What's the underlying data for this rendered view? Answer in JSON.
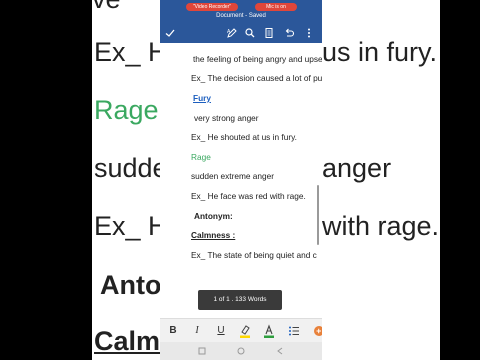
{
  "background": {
    "lines": [
      {
        "text": "ve",
        "green": false,
        "bold": false,
        "ul": false
      },
      {
        "text": "Ex_  He",
        "green": false,
        "bold": false,
        "ul": false
      },
      {
        "text": "us in fury.",
        "green": false,
        "bold": false,
        "ul": false
      },
      {
        "text": "Rage",
        "green": true,
        "bold": false,
        "ul": false
      },
      {
        "text": "suddenext",
        "green": false,
        "bold": false,
        "ul": false
      },
      {
        "text": "anger",
        "green": false,
        "bold": false,
        "ul": false
      },
      {
        "text": "Ex_  H",
        "green": false,
        "bold": false,
        "ul": false
      },
      {
        "text": "with rage.",
        "green": false,
        "bold": false,
        "ul": false
      },
      {
        "text": "Anto",
        "green": false,
        "bold": true,
        "ul": false
      },
      {
        "text": "Calmn",
        "green": false,
        "bold": true,
        "ul": true
      }
    ]
  },
  "status": {
    "left_pill": "\"Video Recorder\"",
    "right_pill": "Mic is on"
  },
  "appbar": {
    "title": "Document - Saved"
  },
  "toolbar": {
    "icons": [
      "check-icon",
      "pen-icon",
      "search-icon",
      "reading-view-icon",
      "undo-icon",
      "more-icon"
    ]
  },
  "document": {
    "lines": [
      {
        "text": "the feeling of being angry and upse",
        "style": "normal"
      },
      {
        "text": "Ex_  The decision caused a lot of pu",
        "style": "normal"
      },
      {
        "text": "Fury",
        "style": "blue-bold-ul"
      },
      {
        "text": "very strong anger",
        "style": "normal"
      },
      {
        "text": "Ex_  He shouted at us in fury.",
        "style": "normal"
      },
      {
        "text": "Rage",
        "style": "green"
      },
      {
        "text": "sudden extreme anger",
        "style": "normal"
      },
      {
        "text": "Ex_ He face was red with rage.",
        "style": "normal"
      },
      {
        "text": "Antonym:",
        "style": "bold"
      },
      {
        "text": "Calmness :",
        "style": "bold-ul"
      },
      {
        "text": "Ex_  The state of being quiet and c",
        "style": "normal"
      }
    ]
  },
  "toast": {
    "text": "1 of 1 . 133 Words"
  },
  "format_bar": {
    "bold": "B",
    "italic": "I",
    "underline": "U",
    "highlight_color": "#ffd800",
    "font_color": "#2e9e3e"
  },
  "colors": {
    "accent": "#2b579a",
    "green_text": "#3aa860",
    "blue_text": "#1d5fbf",
    "status_pill": "#e0463a"
  }
}
